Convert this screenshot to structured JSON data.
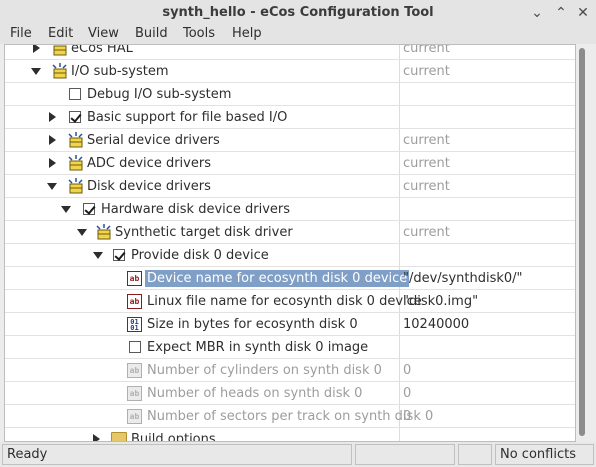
{
  "window": {
    "title": "synth_hello - eCos Configuration Tool",
    "minimize_glyph": "⌄",
    "maximize_glyph": "⌃",
    "close_glyph": "✕"
  },
  "menu": [
    "File",
    "Edit",
    "View",
    "Build",
    "Tools",
    "Help"
  ],
  "tree": {
    "rows": [
      {
        "label": "eCos HAL",
        "value": "current",
        "value_dim": true
      },
      {
        "label": "I/O sub-system",
        "value": "current",
        "value_dim": true
      },
      {
        "label": "Debug I/O sub-system",
        "value": ""
      },
      {
        "label": "Basic support for file based I/O",
        "value": ""
      },
      {
        "label": "Serial device drivers",
        "value": "current",
        "value_dim": true
      },
      {
        "label": "ADC device drivers",
        "value": "current",
        "value_dim": true
      },
      {
        "label": "Disk device drivers",
        "value": "current",
        "value_dim": true
      },
      {
        "label": "Hardware disk device drivers",
        "value": ""
      },
      {
        "label": "Synthetic target disk driver",
        "value": "current",
        "value_dim": true
      },
      {
        "label": "Provide disk 0 device",
        "value": ""
      },
      {
        "label": "Device name for ecosynth disk 0 device",
        "value": "\"/dev/synthdisk0/\""
      },
      {
        "label": "Linux file name for ecosynth disk 0 device",
        "value": "\"disk0.img\""
      },
      {
        "label": "Size in bytes for ecosynth disk 0",
        "value": "10240000"
      },
      {
        "label": "Expect MBR in synth disk 0 image",
        "value": ""
      },
      {
        "label": "Number of cylinders on synth disk 0",
        "value": "0",
        "value_dim": true
      },
      {
        "label": "Number of heads on synth disk 0",
        "value": "0",
        "value_dim": true
      },
      {
        "label": "Number of sectors per track on synth disk 0",
        "value": "0",
        "value_dim": true
      },
      {
        "label": "Build options",
        "value": ""
      }
    ],
    "ab_icon_text": "ab",
    "num_icon_text": "01"
  },
  "status": {
    "left": "Ready",
    "right": "No conflicts"
  }
}
